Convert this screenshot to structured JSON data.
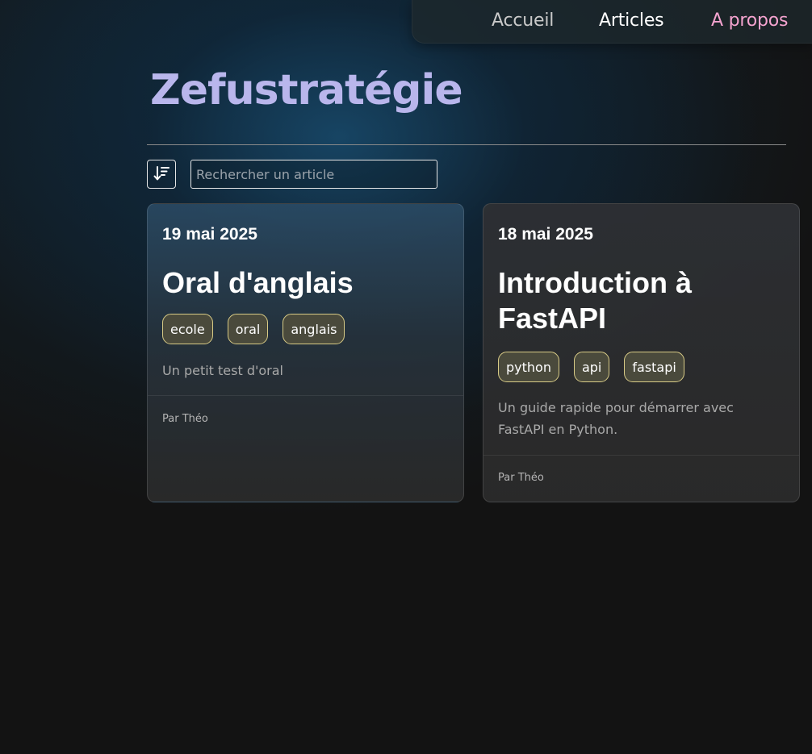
{
  "nav": {
    "items": [
      {
        "label": "Accueil",
        "color": "#c9c9c9"
      },
      {
        "label": "Articles",
        "color": "#ffffff"
      },
      {
        "label": "A propos",
        "color": "#f5a3cf"
      }
    ]
  },
  "site": {
    "title": "Zefustratégie",
    "title_color": "#b9b6ec"
  },
  "toolbar": {
    "sort_icon": "sort-descending-icon",
    "search_placeholder": "Rechercher un article"
  },
  "articles": [
    {
      "date": "19 mai 2025",
      "title": "Oral d'anglais",
      "tags": [
        "ecole",
        "oral",
        "anglais"
      ],
      "description": "Un petit test d'oral",
      "author": "Par Théo"
    },
    {
      "date": "18 mai 2025",
      "title": "Introduction à FastAPI",
      "tags": [
        "python",
        "api",
        "fastapi"
      ],
      "description": "Un guide rapide pour démarrer avec FastAPI en Python.",
      "author": "Par Théo"
    }
  ],
  "colors": {
    "background": "#131313",
    "tag_border": "#d8cb86",
    "tag_background": "#4a4a3c"
  }
}
